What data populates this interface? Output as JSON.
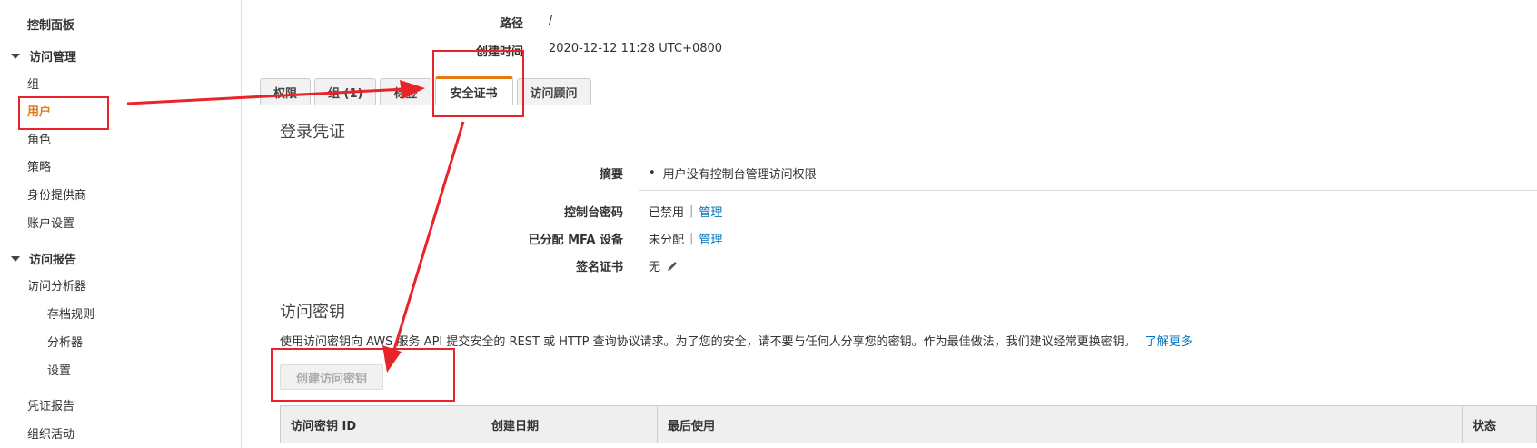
{
  "sidebar": {
    "title": "控制面板",
    "section_access_management": "访问管理",
    "items_access": [
      "组",
      "用户",
      "角色",
      "策略",
      "身份提供商",
      "账户设置"
    ],
    "active_item": "用户",
    "section_access_reports": "访问报告",
    "access_analyzer": "访问分析器",
    "analyzer_children": [
      "存档规则",
      "分析器",
      "设置"
    ],
    "credential_report": "凭证报告",
    "org_activity": "组织活动"
  },
  "summary": {
    "path_label": "路径",
    "path_value": "/",
    "created_label": "创建时间",
    "created_value": "2020-12-12 11:28 UTC+0800"
  },
  "tabs": [
    "权限",
    "组 (1)",
    "标签",
    "安全证书",
    "访问顾问"
  ],
  "active_tab": "安全证书",
  "login_credentials": {
    "title": "登录凭证",
    "summary_label": "摘要",
    "summary_value": "用户没有控制台管理访问权限",
    "console_password_label": "控制台密码",
    "console_password_status": "已禁用",
    "manage_label": "管理",
    "mfa_label": "已分配 MFA 设备",
    "mfa_status": "未分配",
    "signing_cert_label": "签名证书",
    "signing_cert_value": "无"
  },
  "access_keys": {
    "title": "访问密钥",
    "description": "使用访问密钥向 AWS 服务 API 提交安全的 REST 或 HTTP 查询协议请求。为了您的安全，请不要与任何人分享您的密钥。作为最佳做法，我们建议经常更换密钥。",
    "learn_more": "了解更多",
    "create_button": "创建访问密钥",
    "columns": [
      "访问密钥 ID",
      "创建日期",
      "最后使用",
      "状态"
    ]
  },
  "icons": {
    "caret": "caret-down-icon",
    "bullet": "bullet-icon",
    "pencil": "pencil-icon"
  },
  "colors": {
    "accent": "#e47911",
    "link": "#0073bb",
    "annotation": "#e8242a"
  }
}
